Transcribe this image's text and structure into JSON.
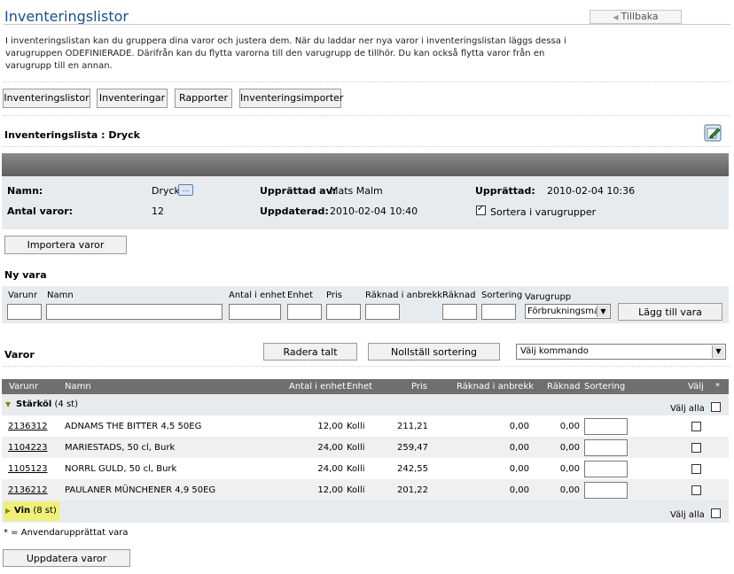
{
  "header": {
    "title": "Inventeringslistor",
    "back_label": "Tillbaka",
    "intro": "I inventeringslistan kan du gruppera dina varor och justera dem. När du laddar ner nya varor i inventeringslistan läggs dessa i varugruppen ODEFINIERADE. Därifrån kan du flytta varorna till den varugrupp de tillhör. Du kan också flytta varor från en varugrupp till en annan."
  },
  "nav": {
    "items": [
      "Inventeringslistor",
      "Inventeringar",
      "Rapporter",
      "Inventeringsimporter"
    ]
  },
  "list": {
    "heading": "Inventeringslista : Dryck",
    "name_label": "Namn:",
    "name_value": "Dryck",
    "name_btn": "...",
    "count_label": "Antal varor:",
    "count_value": "12",
    "created_by_label": "Upprättad av:",
    "created_by_value": "Mats Malm",
    "updated_label": "Uppdaterad:",
    "updated_value": "2010-02-04 10:40",
    "created_label": "Upprättad:",
    "created_value": "2010-02-04 10:36",
    "sort_groups_label": "Sortera i varugrupper",
    "sort_groups_checked": true,
    "import_btn": "Importera varor"
  },
  "new_item": {
    "heading": "Ny vara",
    "labels": {
      "varunr": "Varunr",
      "namn": "Namn",
      "antal": "Antal i enhet",
      "enhet": "Enhet",
      "pris": "Pris",
      "raknad_anbrekk": "Räknad i anbrekk",
      "raknad": "Räknad",
      "sortering": "Sortering",
      "varugrupp": "Varugrupp"
    },
    "varugrupp_value": "Förbrukningsma",
    "add_btn": "Lägg till vara"
  },
  "varor": {
    "heading": "Varor",
    "delete_btn": "Radera talt",
    "reset_btn": "Nollställ sortering",
    "command_select": "Välj kommando",
    "columns": {
      "varunr": "Varunr",
      "namn": "Namn",
      "antal": "Antal i enhet",
      "enhet": "Enhet",
      "pris": "Pris",
      "raknad_anbrekk": "Räknad i anbrekk",
      "raknad": "Räknad",
      "sortering": "Sortering",
      "valj": "Välj",
      "star": "*"
    },
    "select_all_label": "Välj alla",
    "groups": [
      {
        "name": "Stärköl",
        "count": "(4 st)",
        "rows": [
          {
            "varunr": "2136312",
            "namn": "ADNAMS THE BITTER 4,5 50EG",
            "antal": "12,00",
            "enhet": "Kolli",
            "pris": "211,21",
            "anbrekk": "0,00",
            "raknad": "0,00"
          },
          {
            "varunr": "1104223",
            "namn": "MARIESTADS, 50 cl, Burk",
            "antal": "24,00",
            "enhet": "Kolli",
            "pris": "259,47",
            "anbrekk": "0,00",
            "raknad": "0,00"
          },
          {
            "varunr": "1105123",
            "namn": "NORRL GULD, 50 cl, Burk",
            "antal": "24,00",
            "enhet": "Kolli",
            "pris": "242,55",
            "anbrekk": "0,00",
            "raknad": "0,00"
          },
          {
            "varunr": "2136212",
            "namn": "PAULANER MÜNCHENER 4,9 50EG",
            "antal": "12,00",
            "enhet": "Kolli",
            "pris": "201,22",
            "anbrekk": "0,00",
            "raknad": "0,00"
          }
        ]
      },
      {
        "name": "Vin",
        "count": "(8 st)",
        "rows": []
      }
    ],
    "footnote": "* = Anvendarupprättat vara",
    "update_btn": "Uppdatera varor"
  },
  "colors": {
    "title_blue": "#1b4f8a",
    "panel_gray": "#e8ebee",
    "header_dark": "#6f6f6f",
    "highlight_yellow": "#eef07a"
  },
  "icons": {
    "edit": "edit-icon",
    "expand": "triangle-down-icon",
    "collapse": "triangle-right-icon",
    "back": "chevron-left-icon"
  }
}
